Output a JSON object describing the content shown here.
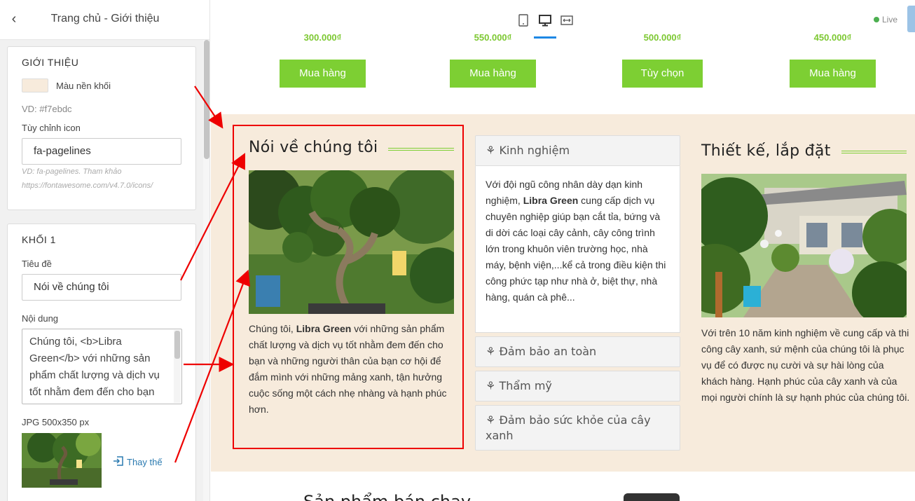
{
  "sidebar": {
    "title": "Trang chủ - Giới thiệu",
    "gioi_thieu": {
      "heading": "GIỚI THIỆU",
      "bg_color_label": "Màu nền khối",
      "bg_color_value": "#f7ebdc",
      "color_hint": "VD: #f7ebdc",
      "icon_label": "Tùy chỉnh icon",
      "icon_value": "fa-pagelines",
      "icon_hint_1": "VD: fa-pagelines. Tham khảo",
      "icon_hint_2": "https://fontawesome.com/v4.7.0/icons/"
    },
    "khoi_1": {
      "heading": "KHỐI 1",
      "title_label": "Tiêu đề",
      "title_value": "Nói về chúng tôi",
      "content_label": "Nội dung",
      "content_value": "Chúng tôi, <b>Libra Green</b> với những sản phẩm chất lượng và dịch vụ tốt nhằm đem đến cho bạn",
      "image_label": "JPG 500x350 px",
      "replace_label": "Thay thế"
    }
  },
  "header": {
    "live_label": "Live",
    "devices": [
      "mobile-icon",
      "desktop-icon",
      "fullwidth-icon"
    ]
  },
  "products": [
    {
      "price": "300.000₫",
      "button": "Mua hàng"
    },
    {
      "price": "550.000₫",
      "button": "Mua hàng"
    },
    {
      "price": "500.000₫",
      "button": "Tùy chọn"
    },
    {
      "price": "450.000₫",
      "button": "Mua hàng"
    }
  ],
  "about": {
    "col1_title": "Nói về chúng tôi",
    "col1_text_pre": "Chúng tôi, ",
    "col1_text_bold": "Libra Green",
    "col1_text_post": " với những sản phẩm chất lượng và dịch vụ tốt nhằm đem đến cho bạn và những người thân của bạn cơ hội để đắm mình với những mảng xanh, tận hưởng cuộc sống một cách nhẹ nhàng và hạnh phúc hơn.",
    "accordion": [
      {
        "title": "Kinh nghiệm"
      },
      {
        "title": "Đảm bảo an toàn"
      },
      {
        "title": "Thẩm mỹ"
      },
      {
        "title": "Đảm bảo sức khỏe của cây xanh"
      }
    ],
    "acc_body_pre": "Với đội ngũ công nhân dày dạn kinh nghiệm, ",
    "acc_body_bold": "Libra Green",
    "acc_body_post": " cung cấp dịch vụ chuyên nghiệp giúp bạn cắt tỉa, bứng và di dời các loại cây cảnh, cây công trình lớn trong khuôn viên trường học, nhà máy, bệnh viện,...kể cả trong điều kiện thi công phức tạp như nhà ở, biệt thự, nhà hàng, quán cà phê...",
    "col3_title": "Thiết kế, lắp đặt",
    "col3_text": "Với trên 10 năm kinh nghiệm về cung cấp và thi công cây xanh, sứ mệnh của chúng tôi là phục vụ để có được nụ cười và sự hài lòng của khách hàng. Hạnh phúc của cây xanh và của mọi người chính là sự hạnh phúc của chúng tôi."
  },
  "next_section": {
    "title": "Sản phẩm bán chạy"
  },
  "colors": {
    "accent_green": "#7dcf33",
    "section_bg": "#f7ebdc",
    "annotation_red": "#e00000"
  }
}
